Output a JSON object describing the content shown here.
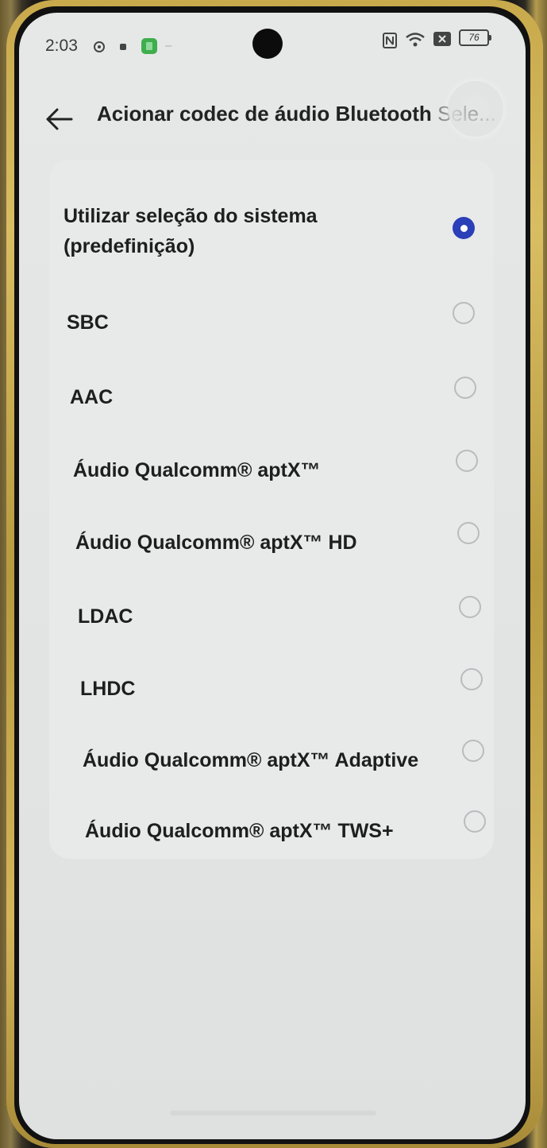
{
  "status_bar": {
    "time": "2:03",
    "battery": "76",
    "icons": [
      "settings-icon",
      "notification-icon",
      "app-icon",
      "nfc-icon",
      "wifi-icon",
      "sim-icon",
      "battery-icon"
    ]
  },
  "header": {
    "title": "Acionar codec de áudio Bluetooth",
    "title_overflow": "Sele..."
  },
  "options": [
    {
      "label": "Utilizar seleção do sistema (predefinição)",
      "selected": true
    },
    {
      "label": "SBC",
      "selected": false
    },
    {
      "label": "AAC",
      "selected": false
    },
    {
      "label": "Áudio Qualcomm® aptX™",
      "selected": false
    },
    {
      "label": "Áudio Qualcomm® aptX™ HD",
      "selected": false
    },
    {
      "label": "LDAC",
      "selected": false
    },
    {
      "label": "LHDC",
      "selected": false
    },
    {
      "label": "Áudio Qualcomm® aptX™ Adaptive",
      "selected": false
    },
    {
      "label": "Áudio Qualcomm® aptX™ TWS+",
      "selected": false
    }
  ],
  "colors": {
    "accent": "#2a3fb8",
    "background": "#e4e6e6",
    "card": "#e8eaea",
    "text": "#1e1e1e"
  }
}
